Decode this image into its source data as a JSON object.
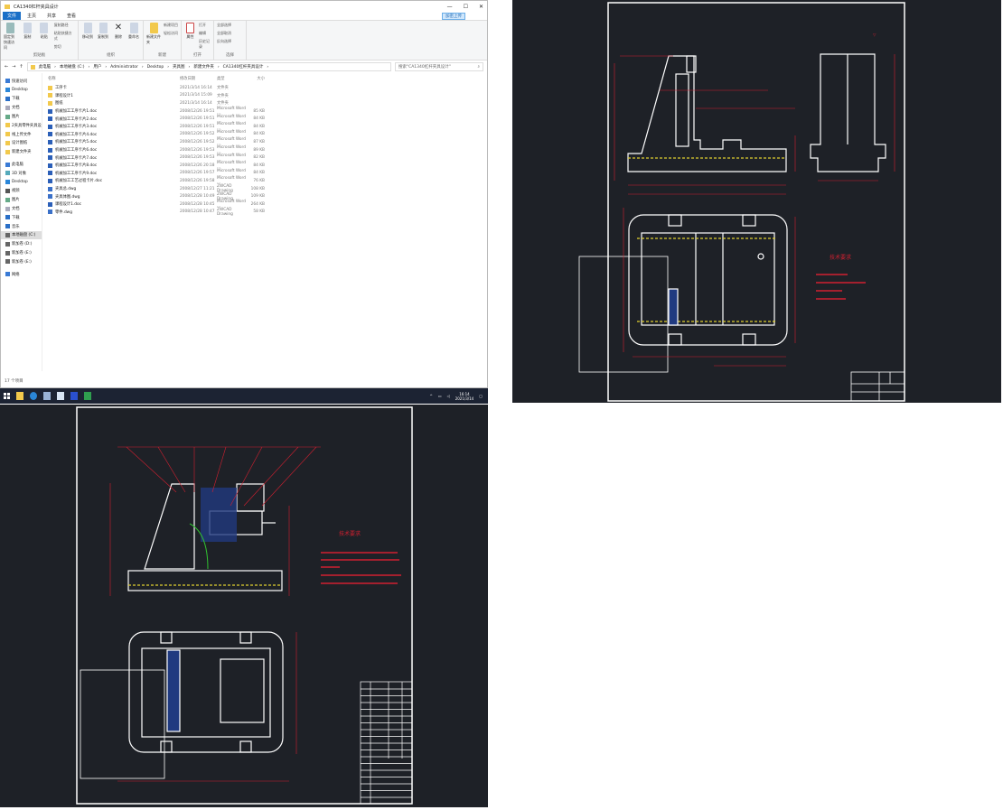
{
  "explorer": {
    "title": "CA1340杠杆夹具设计",
    "window_controls": [
      "—",
      "☐",
      "✕"
    ],
    "tabs": [
      "文件",
      "主页",
      "共享",
      "查看"
    ],
    "share_button": "加密上传",
    "ribbon": {
      "clipboard": {
        "label": "剪贴板",
        "pin": "固定到快速访问",
        "copy": "复制",
        "paste": "粘贴",
        "copy_path": "复制路径",
        "paste_shortcut": "粘贴快捷方式",
        "cut": "剪切"
      },
      "organize": {
        "label": "组织",
        "move_to": "移动到",
        "copy_to": "复制到",
        "delete": "删除",
        "rename": "重命名"
      },
      "new": {
        "label": "新建",
        "new_folder": "新建文件夹",
        "new_item": "新建项目",
        "easy_access": "轻松访问"
      },
      "open": {
        "label": "打开",
        "properties": "属性",
        "open": "打开",
        "edit": "编辑",
        "history": "历史记录"
      },
      "select": {
        "label": "选择",
        "select_all": "全部选择",
        "select_none": "全部取消",
        "invert": "反向选择"
      }
    },
    "breadcrumb": [
      "此电脑",
      "本地磁盘 (C:)",
      "用户",
      "Administrator",
      "Desktop",
      "夹具图",
      "新建文件夹",
      "CA1340杠杆夹具设计"
    ],
    "search_placeholder": "搜索\"CA1340杠杆夹具设计\"",
    "sidebar": [
      {
        "label": "快速访问",
        "icon": "star-icon",
        "sel": false
      },
      {
        "label": "Desktop",
        "icon": "desktop-icon",
        "sel": false
      },
      {
        "label": "下载",
        "icon": "download-icon",
        "sel": false
      },
      {
        "label": "文档",
        "icon": "document-icon",
        "sel": false
      },
      {
        "label": "图片",
        "icon": "picture-icon",
        "sel": false
      },
      {
        "label": "2夹具零件夹具设计",
        "icon": "folder-icon",
        "sel": false
      },
      {
        "label": "线上传文件",
        "icon": "folder-icon",
        "sel": false
      },
      {
        "label": "设计图纸",
        "icon": "folder-icon",
        "sel": false
      },
      {
        "label": "新建文件夹",
        "icon": "folder-icon",
        "sel": false
      },
      {
        "label": "此电脑",
        "icon": "computer-icon",
        "sel": false
      },
      {
        "label": "3D 对象",
        "icon": "cube-icon",
        "sel": false
      },
      {
        "label": "Desktop",
        "icon": "desktop-icon",
        "sel": false
      },
      {
        "label": "视频",
        "icon": "video-icon",
        "sel": false
      },
      {
        "label": "图片",
        "icon": "picture-icon",
        "sel": false
      },
      {
        "label": "文档",
        "icon": "document-icon",
        "sel": false
      },
      {
        "label": "下载",
        "icon": "download-icon",
        "sel": false
      },
      {
        "label": "音乐",
        "icon": "music-icon",
        "sel": false
      },
      {
        "label": "本地磁盘 (C:)",
        "icon": "drive-icon",
        "sel": true
      },
      {
        "label": "新加卷 (D:)",
        "icon": "drive-icon",
        "sel": false
      },
      {
        "label": "新加卷 (E:)",
        "icon": "drive-icon",
        "sel": false
      },
      {
        "label": "新加卷 (E:)",
        "icon": "drive-icon",
        "sel": false
      },
      {
        "label": "网络",
        "icon": "network-icon",
        "sel": false
      }
    ],
    "columns": [
      "名称",
      "修改日期",
      "类型",
      "大小"
    ],
    "files": [
      {
        "name": "工序卡",
        "date": "2021/3/14 16:14",
        "type": "文件夹",
        "size": "",
        "kind": "folder"
      },
      {
        "name": "课程设计1",
        "date": "2021/3/14 15:09",
        "type": "文件夹",
        "size": "",
        "kind": "folder"
      },
      {
        "name": "图纸",
        "date": "2021/3/14 16:14",
        "type": "文件夹",
        "size": "",
        "kind": "folder"
      },
      {
        "name": "机械加工工序卡片1.doc",
        "date": "2008/12/26 19:51",
        "type": "Microsoft Word ...",
        "size": "85 KB",
        "kind": "doc"
      },
      {
        "name": "机械加工工序卡片2.doc",
        "date": "2008/12/26 19:51",
        "type": "Microsoft Word ...",
        "size": "84 KB",
        "kind": "doc"
      },
      {
        "name": "机械加工工序卡片3.doc",
        "date": "2008/12/26 19:51",
        "type": "Microsoft Word ...",
        "size": "84 KB",
        "kind": "doc"
      },
      {
        "name": "机械加工工序卡片4.doc",
        "date": "2008/12/26 19:52",
        "type": "Microsoft Word ...",
        "size": "84 KB",
        "kind": "doc"
      },
      {
        "name": "机械加工工序卡片5.doc",
        "date": "2008/12/26 19:52",
        "type": "Microsoft Word ...",
        "size": "87 KB",
        "kind": "doc"
      },
      {
        "name": "机械加工工序卡片6.doc",
        "date": "2008/12/26 19:53",
        "type": "Microsoft Word ...",
        "size": "89 KB",
        "kind": "doc"
      },
      {
        "name": "机械加工工序卡片7.doc",
        "date": "2008/12/26 19:53",
        "type": "Microsoft Word ...",
        "size": "82 KB",
        "kind": "doc"
      },
      {
        "name": "机械加工工序卡片8.doc",
        "date": "2008/12/26 20:18",
        "type": "Microsoft Word ...",
        "size": "84 KB",
        "kind": "doc"
      },
      {
        "name": "机械加工工序卡片9.doc",
        "date": "2008/12/26 19:57",
        "type": "Microsoft Word ...",
        "size": "84 KB",
        "kind": "doc"
      },
      {
        "name": "机械加工工艺过程卡片.doc",
        "date": "2008/12/26 19:58",
        "type": "Microsoft Word ...",
        "size": "76 KB",
        "kind": "doc"
      },
      {
        "name": "夹具总.dwg",
        "date": "2008/12/27 11:21",
        "type": "ZWCAD Drawing",
        "size": "108 KB",
        "kind": "dwg"
      },
      {
        "name": "夹具体图.dwg",
        "date": "2008/12/28 10:49",
        "type": "ZWCAD Drawing",
        "size": "109 KB",
        "kind": "dwg"
      },
      {
        "name": "课程设计1.doc",
        "date": "2008/12/28 10:45",
        "type": "Microsoft Word ...",
        "size": "264 KB",
        "kind": "doc"
      },
      {
        "name": "零件.dwg",
        "date": "2008/12/28 10:47",
        "type": "ZWCAD Drawing",
        "size": "58 KB",
        "kind": "dwg"
      }
    ],
    "status": "17 个项目"
  },
  "taskbar": {
    "apps": [
      "start-icon",
      "file-explorer-icon",
      "browser-icon",
      "document-app-icon",
      "cad-app-icon",
      "cad-viewer-icon",
      "spreadsheet-icon"
    ],
    "time": "16:14",
    "date": "2021/3/14"
  },
  "cad_part": {
    "tech_title": "技术要求",
    "background": "#1e2127",
    "line_color": "#d02030"
  },
  "cad_assembly": {
    "tech_title": "技术要求"
  }
}
